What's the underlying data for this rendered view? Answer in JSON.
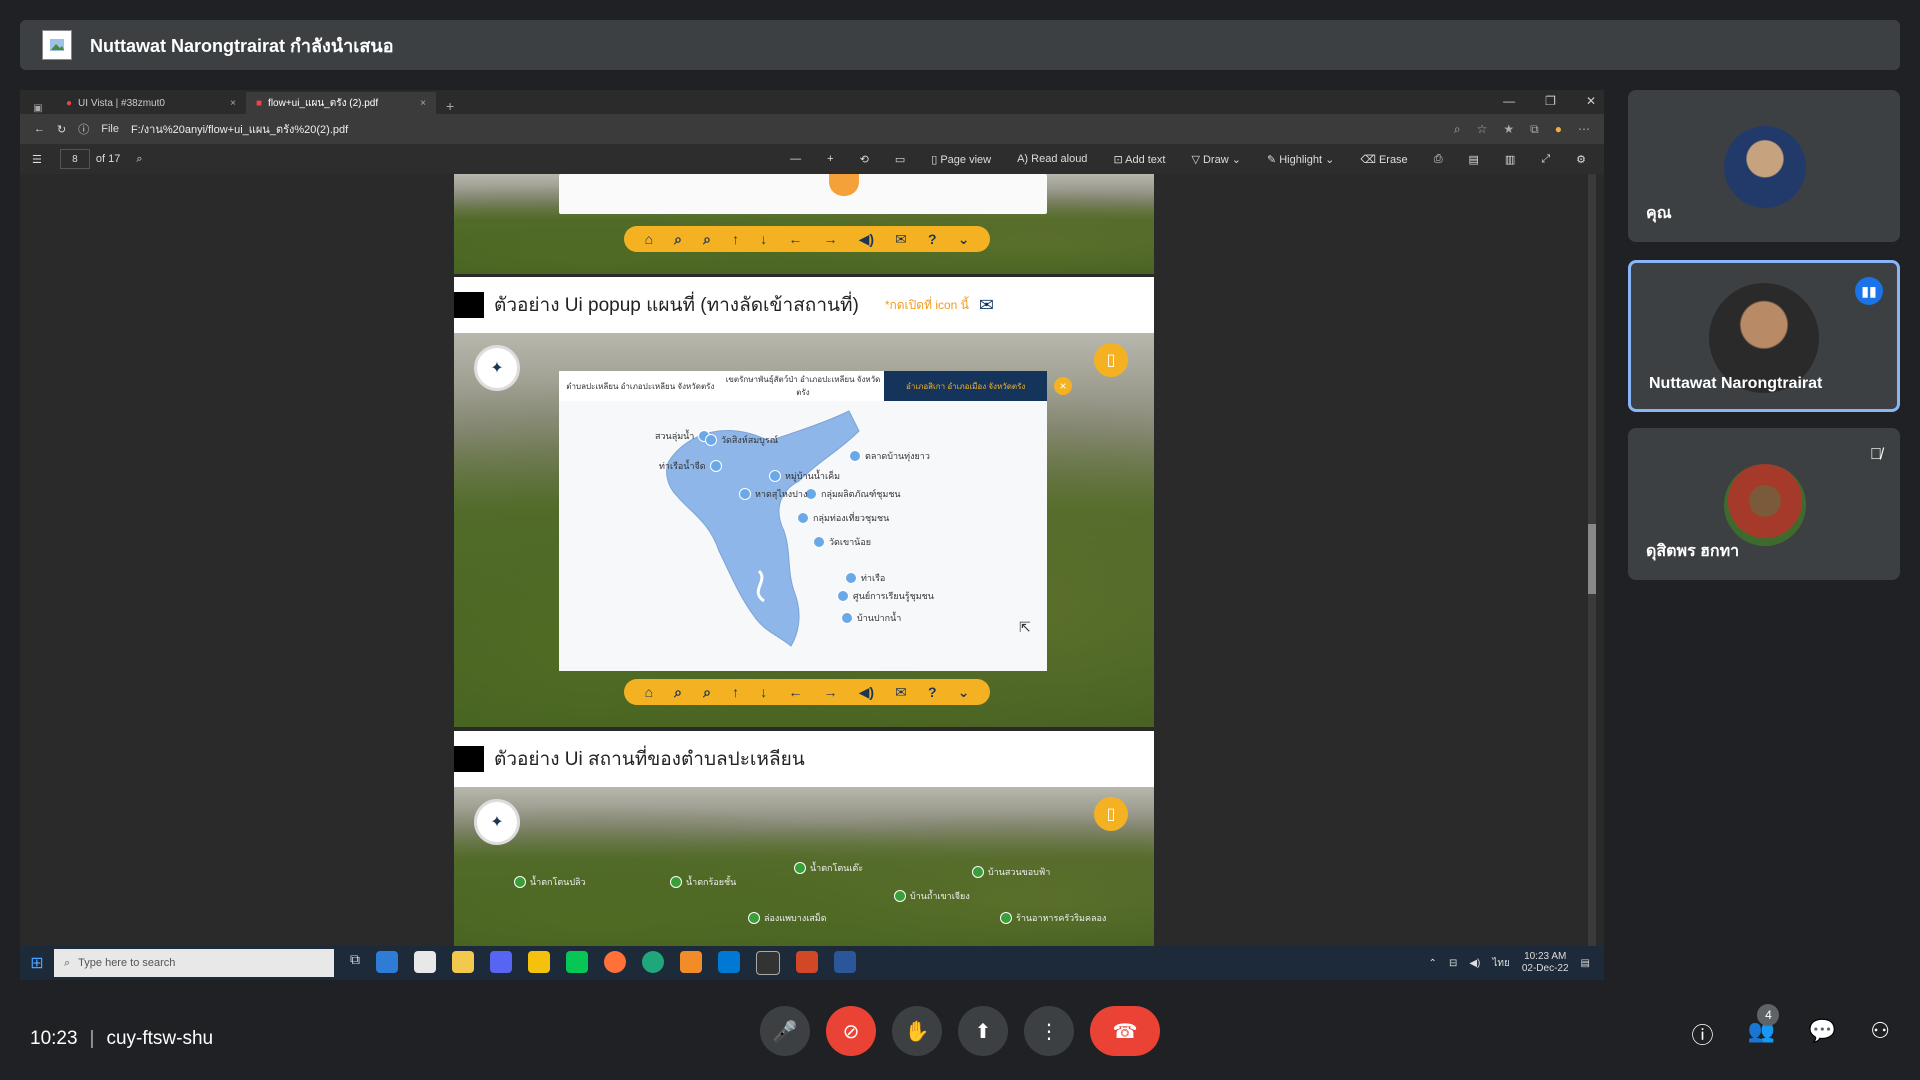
{
  "presenter_bar": {
    "title": "Nuttawat Narongtrairat กำลังนำเสนอ"
  },
  "browser": {
    "tabs": [
      {
        "label": "UI Vista | #38zmut0",
        "close": "×"
      },
      {
        "label": "flow+ui_แผน_ตรัง (2).pdf",
        "close": "×"
      }
    ],
    "new_tab": "+",
    "window_controls": [
      "—",
      "❐",
      "✕"
    ],
    "address": {
      "scheme": "File",
      "url": "F:/งาน%20anyi/flow+ui_แผน_ตรัง%20(2).pdf"
    }
  },
  "pdf_toolbar": {
    "page_current": "8",
    "page_total": "of 17",
    "page_view": "Page view",
    "read_aloud": "Read aloud",
    "add_text": "Add text",
    "draw": "Draw",
    "highlight": "Highlight",
    "erase": "Erase"
  },
  "pdf_content": {
    "section1": {
      "heading": "ตัวอย่าง Ui popup แผนที่ (ทางลัดเข้าสถานที่)",
      "note": "*กดเปิดที่ icon นี้",
      "map_tabs": [
        "ตำบลปะเหลียน อำเภอปะเหลียน จังหวัดตรัง",
        "เขตรักษาพันธุ์สัตว์ป่า อำเภอปะเหลียน จังหวัดตรัง",
        "อำเภอสิเกา อำเภอเมือง จังหวัดตรัง"
      ],
      "map_places": [
        "สวนลุ่มน้ำ",
        "วัดสิงห์สมบูรณ์",
        "ตลาดบ้านทุ่งยาว",
        "ท่าเรือน้ำจืด",
        "หมู่บ้านน้ำเค็ม",
        "กลุ่มผลิตภัณฑ์ชุมชน",
        "หาดสุไหงปาง",
        "กลุ่มท่องเที่ยวชุมชน",
        "วัดเขาน้อย",
        "ท่าเรือ",
        "ศูนย์การเรียนรู้ชุมชน",
        "บ้านปากน้ำ"
      ]
    },
    "section2": {
      "heading": "ตัวอย่าง Ui สถานที่ของตำบลปะเหลียน",
      "places": [
        "น้ำตกโตนปลิว",
        "น้ำตกร้อยชั้น",
        "น้ำตกโตนเต๊ะ",
        "บ้านสวนขอบฟ้า",
        "บ้านถ้ำเขาเจียง",
        "ล่องแพบางเสม็ด",
        "ร้านอาหารครัวริมคลอง"
      ]
    }
  },
  "taskbar": {
    "search_placeholder": "Type here to search",
    "lang": "ไทย",
    "time": "10:23 AM",
    "date": "02-Dec-22"
  },
  "participants": [
    {
      "name": "คุณ"
    },
    {
      "name": "Nuttawat Narongtrairat"
    },
    {
      "name": "ดุสิตพร ฮกทา"
    }
  ],
  "meeting": {
    "time": "10:23",
    "code": "cuy-ftsw-shu",
    "people_count": "4"
  },
  "colors": {
    "accent": "#f4b223",
    "navy": "#14345c",
    "meet_bg": "#202124",
    "hangup": "#ea4335",
    "active_border": "#8ab4f8",
    "speaking": "#1a73e8"
  }
}
